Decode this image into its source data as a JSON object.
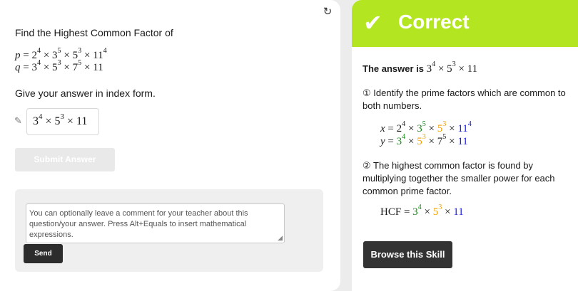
{
  "question": {
    "title": "Find the Highest Common Factor of",
    "p_label": "p",
    "q_label": "q",
    "instruction": "Give your answer in index form."
  },
  "answer": {
    "b1": "3",
    "e1": "4",
    "b2": "5",
    "e2": "3",
    "b3": "11"
  },
  "buttons": {
    "submit": "Submit Answer",
    "send": "Send",
    "browse": "Browse this Skill"
  },
  "comment": {
    "placeholder": "You can optionally leave a comment for your teacher about this question/your answer. Press Alt+Equals to insert mathematical expressions."
  },
  "feedback": {
    "status": "Correct",
    "answer_prefix": "The answer is",
    "step1": "① Identify the prime factors which are common to both numbers.",
    "x_label": "x",
    "y_label": "y",
    "step2": "② The highest common factor is found by multiplying together the smaller power for each common prime factor.",
    "hcf_label": "HCF"
  },
  "colors": {
    "banner": "#b4e521",
    "common_3": "#1a8a1a",
    "common_5": "#f0a000",
    "common_11": "#1a1ae0"
  },
  "icons": {
    "refresh": "refresh-icon",
    "pencil": "pencil-icon",
    "check": "checkmark-icon"
  }
}
